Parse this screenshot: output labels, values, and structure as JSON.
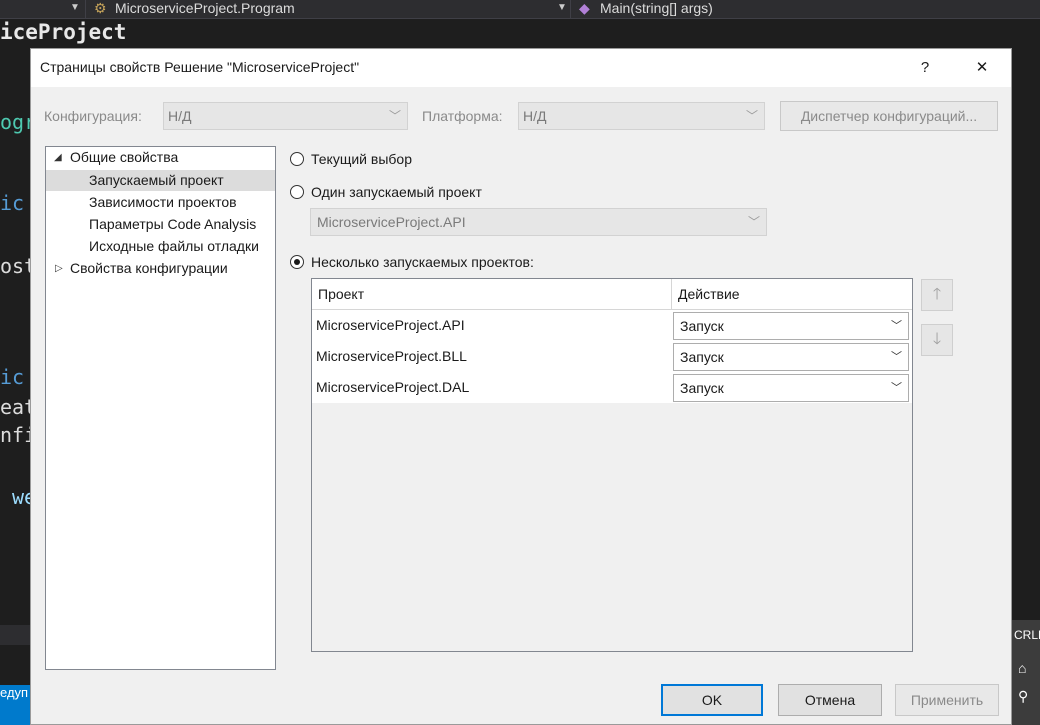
{
  "ide": {
    "nav_left": "MicroserviceProject.Program",
    "nav_right": "Main(string[] args)",
    "title": "iceProject",
    "code_fragments": [
      "ogr",
      "ic",
      "ost",
      "ic",
      "eat",
      "nfi",
      "we"
    ],
    "bottom_right": "CRLF",
    "status_left": "едуп"
  },
  "dialog": {
    "title": "Страницы свойств Решение \"MicroserviceProject\"",
    "help_label": "?",
    "close_label": "✕",
    "config": {
      "config_label": "Конфигурация:",
      "config_value": "Н/Д",
      "platform_label": "Платформа:",
      "platform_value": "Н/Д",
      "manager_button": "Диспетчер конфигураций..."
    },
    "tree": {
      "group1": "Общие свойства",
      "items": [
        "Запускаемый проект",
        "Зависимости проектов",
        "Параметры Code Analysis",
        "Исходные файлы отладки"
      ],
      "group2": "Свойства конфигурации"
    },
    "startup": {
      "current_label": "Текущий выбор",
      "single_label": "Один запускаемый проект",
      "single_value": "MicroserviceProject.API",
      "multiple_label": "Несколько запускаемых проектов:",
      "selected": "multiple"
    },
    "grid": {
      "col_project": "Проект",
      "col_action": "Действие",
      "rows": [
        {
          "project": "MicroserviceProject.API",
          "action": "Запуск"
        },
        {
          "project": "MicroserviceProject.BLL",
          "action": "Запуск"
        },
        {
          "project": "MicroserviceProject.DAL",
          "action": "Запуск"
        }
      ]
    },
    "buttons": {
      "ok": "OK",
      "cancel": "Отмена",
      "apply": "Применить"
    }
  }
}
